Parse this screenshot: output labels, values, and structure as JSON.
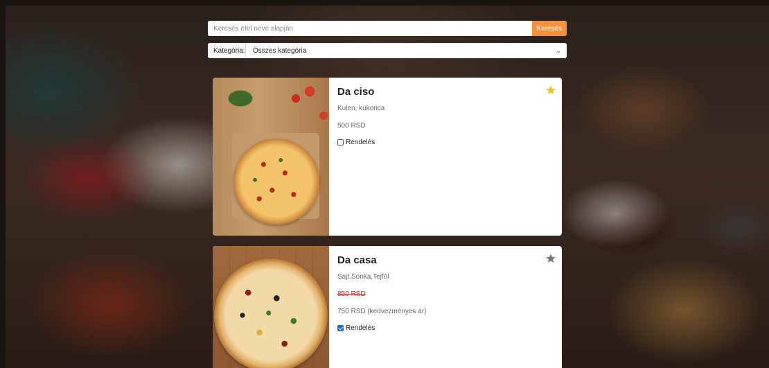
{
  "search": {
    "placeholder": "Keresés étel neve alapján",
    "button_label": "Keresés"
  },
  "category": {
    "label": "Kategória:",
    "selected": "Összes kategória"
  },
  "items": [
    {
      "name": "Da ciso",
      "description": "Kulen, kukorica",
      "price": "500 RSD",
      "order_label": "Rendelés",
      "order_checked": false,
      "favorite": true
    },
    {
      "name": "Da casa",
      "description": "Sajt,Sonka,Tejföl",
      "old_price": "850 RSD",
      "price": "750 RSD (kedvezményes ár)",
      "order_label": "Rendelés",
      "order_checked": true,
      "favorite": false
    }
  ],
  "colors": {
    "accent": "#f5913a",
    "favorite_star": "#f2c318",
    "inactive_star": "#777777",
    "old_price": "#e02020"
  }
}
